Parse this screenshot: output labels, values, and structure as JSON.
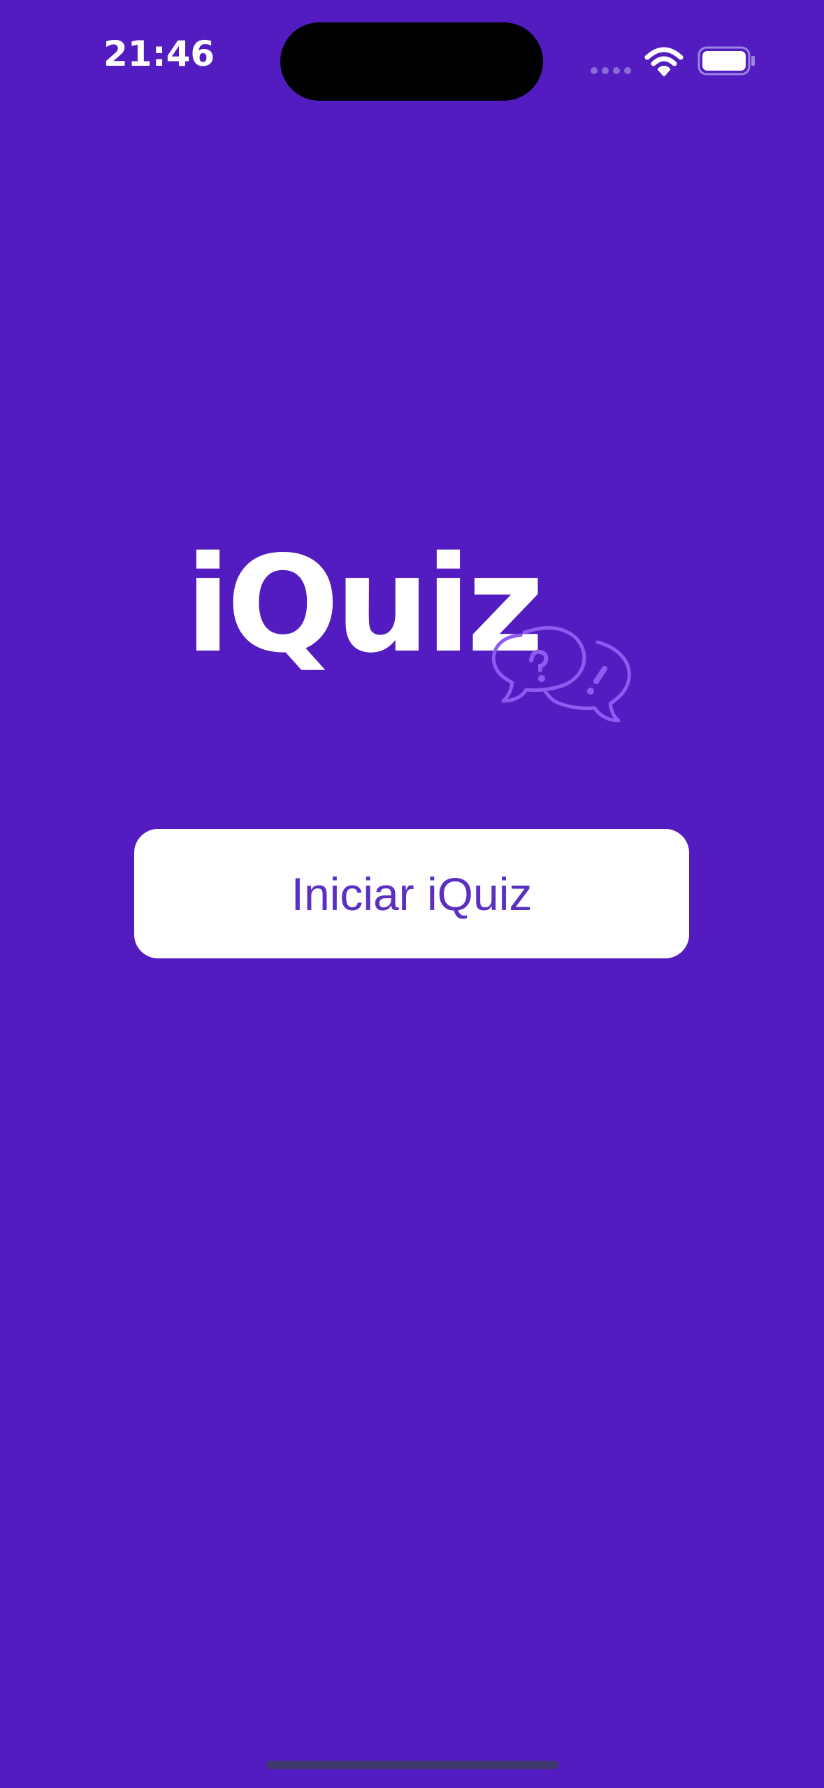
{
  "status_bar": {
    "time": "21:46",
    "icons": [
      "signal-icon",
      "wifi-icon",
      "battery-icon"
    ]
  },
  "logo": {
    "text": "iQuiz",
    "icon": "chat-bubbles-question-exclamation-icon"
  },
  "start_button": {
    "label": "Iniciar iQuiz"
  },
  "colors": {
    "background": "#521cc0",
    "button_background": "#ffffff",
    "button_text": "#5a2fc2",
    "logo_text": "#ffffff",
    "bubble_accent": "#8c5cf2"
  }
}
